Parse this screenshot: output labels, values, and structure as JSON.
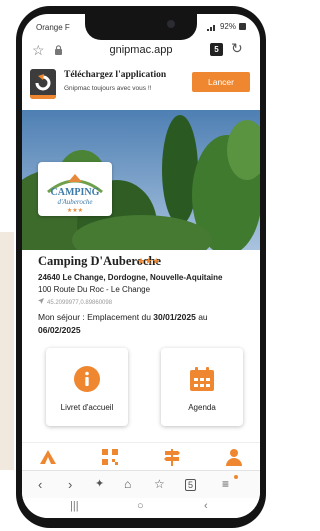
{
  "status": {
    "carrier": "Orange F",
    "battery": "92%"
  },
  "browser": {
    "url": "gnipmac.app",
    "tabs_count": "5"
  },
  "banner": {
    "title": "Téléchargez l'application",
    "subtitle": "Gnipmac toujours avec vous !!",
    "launch_label": "Lancer"
  },
  "camping": {
    "name": "Camping D'Auberoche",
    "stars": "★★★",
    "address_line1": "24640 Le Change, Dordogne, Nouvelle-Aquitaine",
    "address_line2": "100 Route Du Roc - Le Change",
    "gps": "45.2099977,0.89860098",
    "sejour_prefix": "Mon séjour : Emplacement du ",
    "date_from": "30/01/2025",
    "sejour_mid": " au",
    "date_to": "06/02/2025",
    "logo_text_1": "CAMPING",
    "logo_text_2": "d'Auberoche",
    "logo_stars": "★★★"
  },
  "cards": {
    "livret_label": "Livret d'accueil",
    "agenda_label": "Agenda"
  },
  "colors": {
    "accent": "#ef8730",
    "dark": "#3c3c3c"
  },
  "icons": {
    "banner_logo": "app-logo-icon",
    "nav": [
      "camp-tent-icon",
      "qr-code-icon",
      "signpost-icon",
      "user-icon"
    ],
    "browser": [
      "back-arrow-icon",
      "forward-arrow-icon",
      "sparkle-icon",
      "home-icon",
      "bookmark-add-icon",
      "tabs-icon",
      "menu-icon"
    ],
    "cards": [
      "info-icon",
      "calendar-icon"
    ]
  }
}
